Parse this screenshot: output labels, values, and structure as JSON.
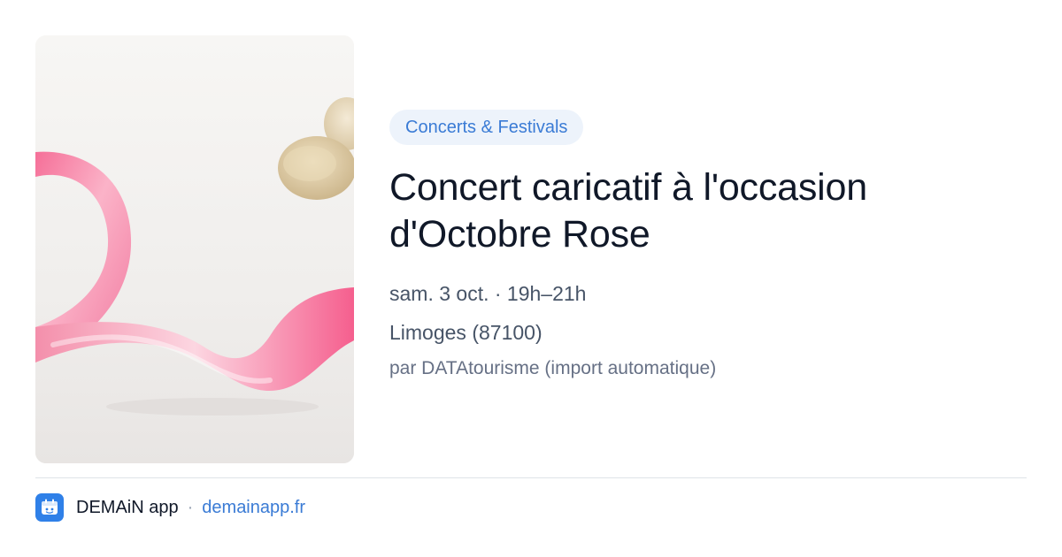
{
  "image": {
    "alt": "",
    "icon": "pink-ribbon-photo"
  },
  "event": {
    "category": "Concerts & Festivals",
    "title": "Concert caricatif à l'occasion d'Octobre Rose",
    "datetime": "sam. 3 oct. · 19h–21h",
    "location": "Limoges (87100)",
    "source": "par DATAtourisme (import automatique)"
  },
  "footer": {
    "app_name": "DEMAiN app",
    "separator": "·",
    "link_text": "demainapp.fr",
    "logo_icon": "demain-app-logo-icon"
  },
  "colors": {
    "accent": "#3a7bd5",
    "chip_bg": "#edf3fb",
    "title": "#101828",
    "meta": "#475467",
    "logo_bg": "#2f80e8"
  }
}
